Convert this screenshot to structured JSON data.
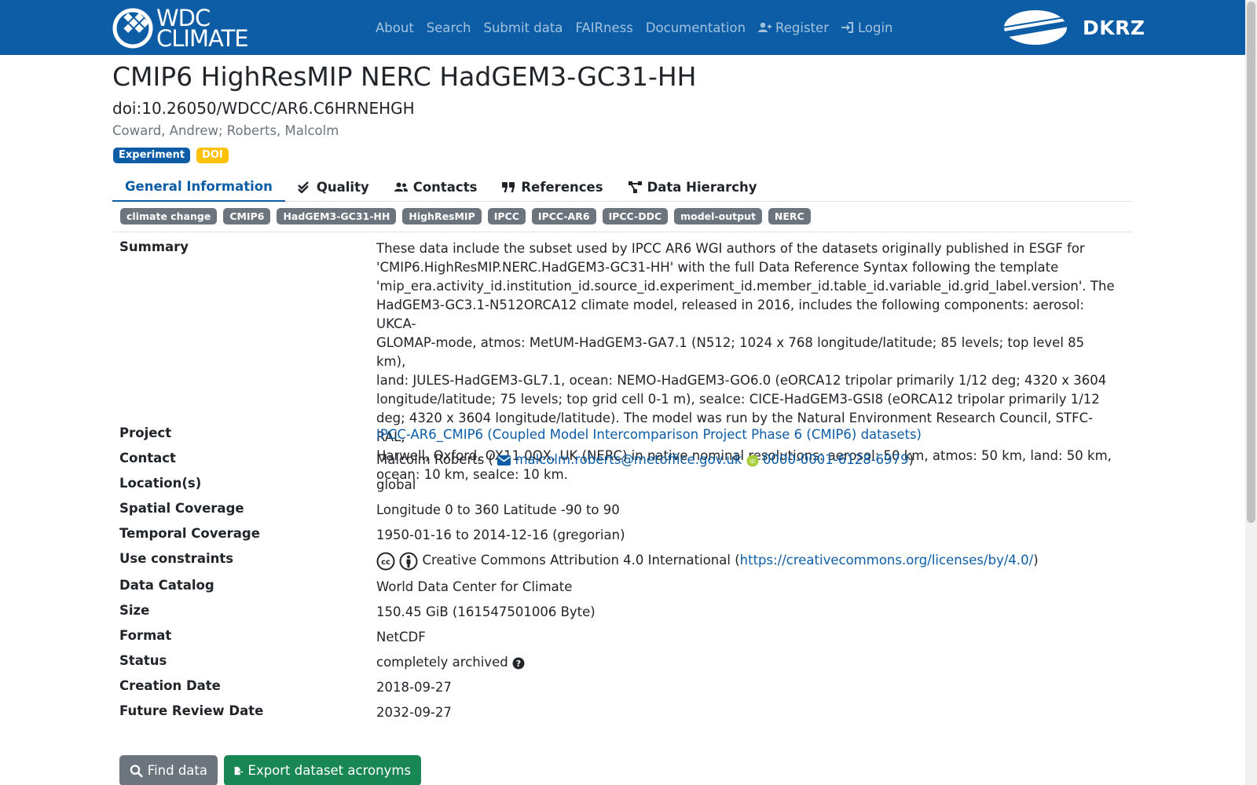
{
  "brand": {
    "line1": "WDC",
    "line2": "CLIMATE"
  },
  "nav": {
    "items": [
      {
        "label": "About",
        "icon": ""
      },
      {
        "label": "Search",
        "icon": ""
      },
      {
        "label": "Submit data",
        "icon": ""
      },
      {
        "label": "FAIRness",
        "icon": ""
      },
      {
        "label": "Documentation",
        "icon": ""
      },
      {
        "label": "Register",
        "icon": "user-plus-icon"
      },
      {
        "label": "Login",
        "icon": "sign-in-icon"
      }
    ],
    "partner_logo": "DKRZ"
  },
  "header": {
    "title": "CMIP6 HighResMIP NERC HadGEM3-GC31-HH",
    "doi": "doi:10.26050/WDCC/AR6.C6HRNEHGH",
    "authors": "Coward, Andrew; Roberts, Malcolm",
    "badges": [
      "Experiment",
      "DOI"
    ]
  },
  "tabs": [
    {
      "label": "General Information",
      "active": true
    },
    {
      "label": "Quality",
      "icon": "check-double-icon"
    },
    {
      "label": "Contacts",
      "icon": "users-icon"
    },
    {
      "label": "References",
      "icon": "quote-icon"
    },
    {
      "label": "Data Hierarchy",
      "icon": "hierarchy-icon"
    }
  ],
  "keywords": [
    "climate change",
    "CMIP6",
    "HadGEM3-GC31-HH",
    "HighResMIP",
    "IPCC",
    "IPCC-AR6",
    "IPCC-DDC",
    "model-output",
    "NERC"
  ],
  "details": {
    "summary": {
      "label": "Summary",
      "lines": [
        "These data include the subset used by IPCC AR6 WGI authors of the datasets originally published in ESGF for",
        "'CMIP6.HighResMIP.NERC.HadGEM3-GC31-HH' with the full Data Reference Syntax following the template",
        "'mip_era.activity_id.institution_id.source_id.experiment_id.member_id.table_id.variable_id.grid_label.version'. The",
        "HadGEM3-GC3.1-N512ORCA12 climate model, released in 2016, includes the following components: aerosol: UKCA-",
        "GLOMAP-mode, atmos: MetUM-HadGEM3-GA7.1 (N512; 1024 x 768 longitude/latitude; 85 levels; top level 85 km),",
        "land: JULES-HadGEM3-GL7.1, ocean: NEMO-HadGEM3-GO6.0 (eORCA12 tripolar primarily 1/12 deg; 4320 x 3604",
        "longitude/latitude; 75 levels; top grid cell 0-1 m), seaIce: CICE-HadGEM3-GSI8 (eORCA12 tripolar primarily 1/12",
        "deg; 4320 x 3604 longitude/latitude). The model was run by the Natural Environment Research Council, STFC-RAL,",
        "Harwell, Oxford, OX11 0QX, UK (NERC) in native nominal resolutions: aerosol: 50 km, atmos: 50 km, land: 50 km,",
        "ocean: 10 km, seaIce: 10 km."
      ]
    },
    "project": {
      "label": "Project",
      "value": "IPCC-AR6_CMIP6 (Coupled Model Intercomparison Project Phase 6 (CMIP6) datasets)"
    },
    "contact": {
      "label": "Contact",
      "name": "Malcolm Roberts (",
      "email": "malcolm.roberts@metoffice.gov.uk",
      "orcid": "0000-0001-6128-6979",
      "close": ")"
    },
    "location": {
      "label": "Location(s)",
      "value": "global"
    },
    "spatial": {
      "label": "Spatial Coverage",
      "value": "Longitude 0 to 360 Latitude -90 to 90"
    },
    "temporal": {
      "label": "Temporal Coverage",
      "value": "1950-01-16 to 2014-12-16 (gregorian)"
    },
    "constraints": {
      "label": "Use constraints",
      "license": "Creative Commons Attribution 4.0 International (",
      "url": "https://creativecommons.org/licenses/by/4.0/",
      "close": ")"
    },
    "catalog": {
      "label": "Data Catalog",
      "value": "World Data Center for Climate"
    },
    "size": {
      "label": "Size",
      "value": "150.45 GiB (161547501006 Byte)"
    },
    "format": {
      "label": "Format",
      "value": "NetCDF"
    },
    "status": {
      "label": "Status",
      "value": "completely archived"
    },
    "creation": {
      "label": "Creation Date",
      "value": "2018-09-27"
    },
    "review": {
      "label": "Future Review Date",
      "value": "2032-09-27"
    }
  },
  "buttons": {
    "find": "Find data",
    "export": "Export dataset acronyms"
  },
  "colors": {
    "navbar": "#0d5da6",
    "link": "#0d5da6",
    "badge_experiment": "#0d5da6",
    "badge_doi": "#ffc107",
    "keyword": "#6c757d",
    "find_button": "#6c757d",
    "export_button": "#198754",
    "orcid": "#a6ce39"
  }
}
